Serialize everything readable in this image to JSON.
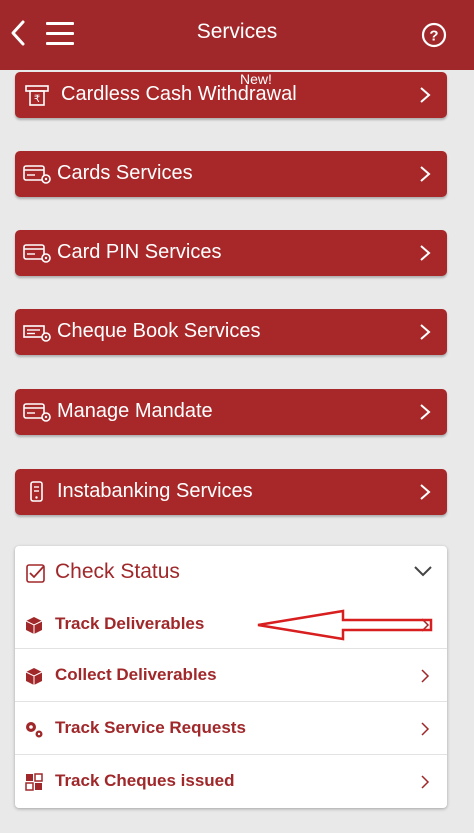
{
  "header": {
    "title": "Services"
  },
  "menu": [
    {
      "label": "Cardless Cash Withdrawal",
      "badge": "New!",
      "icon": "rupee-atm-icon"
    },
    {
      "label": "Cards Services",
      "icon": "card-gear-icon"
    },
    {
      "label": "Card PIN Services",
      "icon": "card-gear-icon"
    },
    {
      "label": "Cheque Book Services",
      "icon": "cheque-gear-icon"
    },
    {
      "label": "Manage Mandate",
      "icon": "card-gear-icon"
    },
    {
      "label": "Instabanking Services",
      "icon": "mobile-icon"
    }
  ],
  "check_status": {
    "title": "Check Status",
    "items": [
      {
        "label": "Track Deliverables",
        "icon": "package-icon"
      },
      {
        "label": "Collect Deliverables",
        "icon": "package-icon"
      },
      {
        "label": "Track Service Requests",
        "icon": "gears-icon"
      },
      {
        "label": "Track Cheques issued",
        "icon": "cheque-grid-icon"
      }
    ]
  },
  "colors": {
    "primary": "#a0282a",
    "background": "#e9e9e9",
    "annotation_arrow": "#d81e1e"
  }
}
